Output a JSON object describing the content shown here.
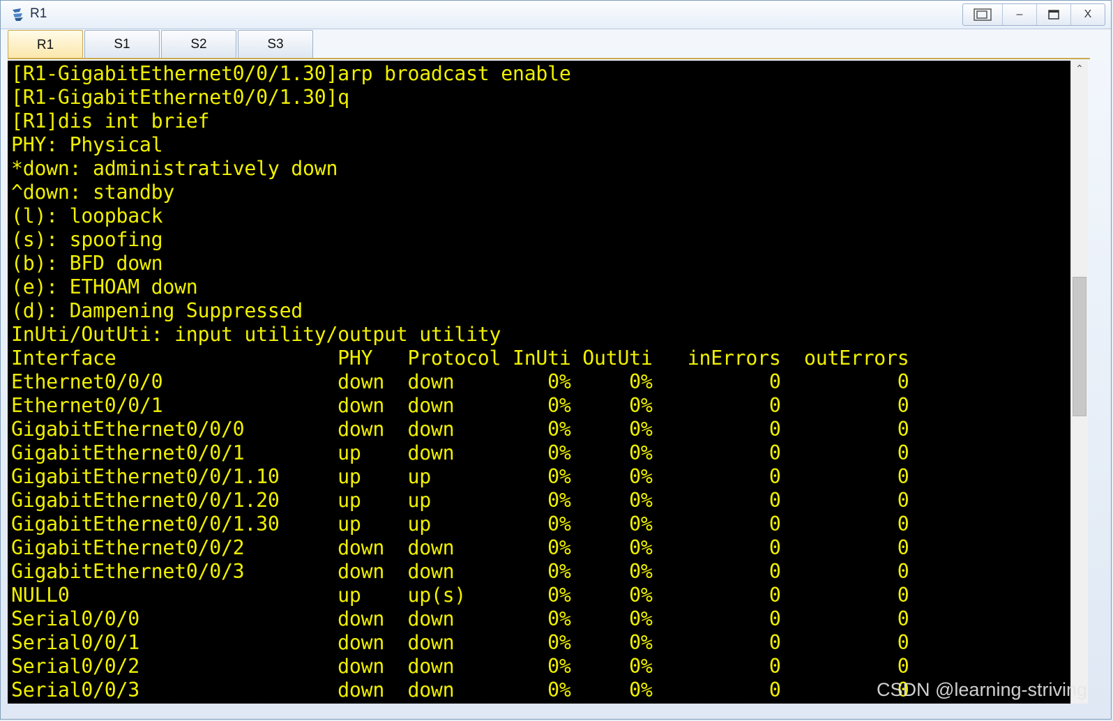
{
  "window": {
    "title": "R1",
    "controls": {
      "restore_label": "⧉",
      "minimize_label": "–",
      "maximize_label": "☐",
      "close_label": "X"
    }
  },
  "tabs": [
    {
      "label": "R1",
      "active": true
    },
    {
      "label": "S1",
      "active": false
    },
    {
      "label": "S2",
      "active": false
    },
    {
      "label": "S3",
      "active": false
    }
  ],
  "terminal": {
    "text_color": "#f0f000",
    "background": "#000000",
    "lines": [
      "[R1-GigabitEthernet0/0/1.30]arp broadcast enable",
      "[R1-GigabitEthernet0/0/1.30]q",
      "[R1]dis int brief",
      "PHY: Physical",
      "*down: administratively down",
      "^down: standby",
      "(l): loopback",
      "(s): spoofing",
      "(b): BFD down",
      "(e): ETHOAM down",
      "(d): Dampening Suppressed",
      "InUti/OutUti: input utility/output utility",
      "Interface                   PHY   Protocol InUti OutUti   inErrors  outErrors",
      "Ethernet0/0/0               down  down        0%     0%          0          0",
      "Ethernet0/0/1               down  down        0%     0%          0          0",
      "GigabitEthernet0/0/0        down  down        0%     0%          0          0",
      "GigabitEthernet0/0/1        up    down        0%     0%          0          0",
      "GigabitEthernet0/0/1.10     up    up          0%     0%          0          0",
      "GigabitEthernet0/0/1.20     up    up          0%     0%          0          0",
      "GigabitEthernet0/0/1.30     up    up          0%     0%          0          0",
      "GigabitEthernet0/0/2        down  down        0%     0%          0          0",
      "GigabitEthernet0/0/3        down  down        0%     0%          0          0",
      "NULL0                       up    up(s)       0%     0%          0          0",
      "Serial0/0/0                 down  down        0%     0%          0          0",
      "Serial0/0/1                 down  down        0%     0%          0          0",
      "Serial0/0/2                 down  down        0%     0%          0          0",
      "Serial0/0/3                 down  down        0%     0%          0          0"
    ]
  },
  "scrollbar": {
    "up_arrow": "⌃"
  },
  "watermark": "CSDN @learning-striving"
}
